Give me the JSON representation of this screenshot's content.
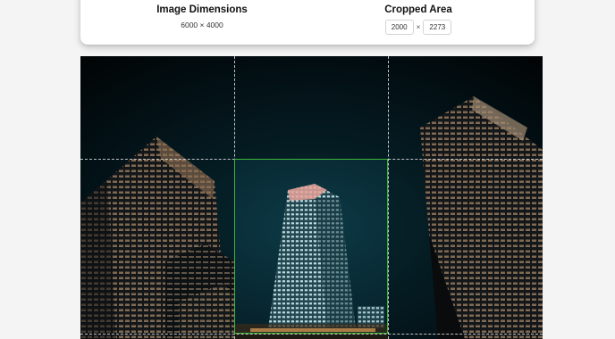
{
  "image_info": {
    "dimensions_title": "Image Dimensions",
    "dimensions_value": "6000 × 4000",
    "crop_title": "Cropped Area",
    "crop_width": "2000",
    "crop_height": "2273",
    "crop_separator": "×"
  },
  "colors": {
    "crop_border": "#3fb53a",
    "sky": "#06171d",
    "tower_glow": "#cfe9ee",
    "window_warm": "#d9b48a"
  },
  "photo": {
    "subject": "city-skyscrapers-night-photo"
  }
}
